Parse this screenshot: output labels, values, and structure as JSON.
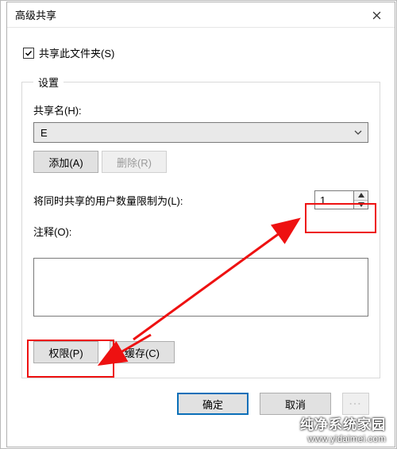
{
  "window": {
    "title": "高级共享",
    "close_label": "关闭"
  },
  "share": {
    "checkbox_label": "共享此文件夹(S)",
    "checked": true
  },
  "settings": {
    "legend": "设置",
    "share_name_label": "共享名(H):",
    "share_name_value": "E",
    "add_label": "添加(A)",
    "remove_label": "删除(R)",
    "limit_label": "将同时共享的用户数量限制为(L):",
    "limit_value": "1",
    "comment_label": "注释(O):",
    "comment_value": "",
    "permissions_label": "权限(P)",
    "cache_label": "缓存(C)"
  },
  "buttons": {
    "ok": "确定",
    "cancel": "取消"
  },
  "watermark": {
    "text": "纯净系统家园",
    "url": "www.yidaimei.com"
  }
}
